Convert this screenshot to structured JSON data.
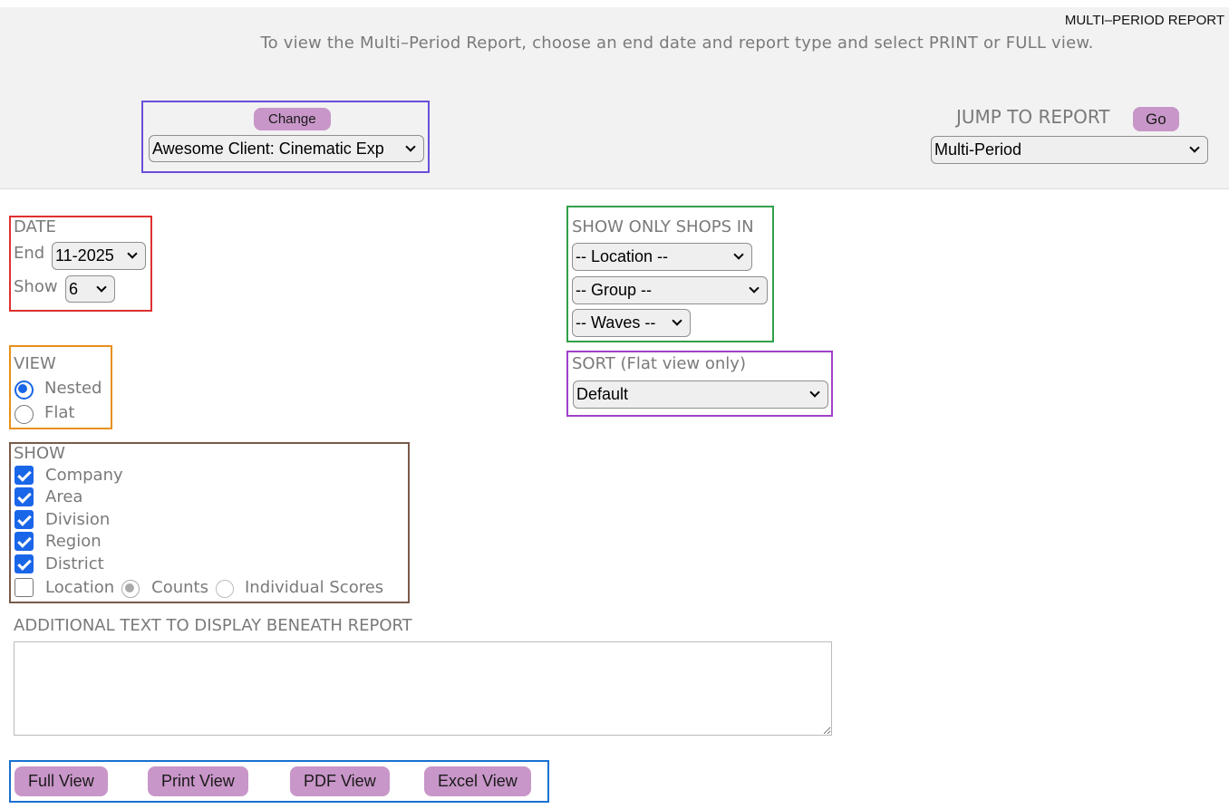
{
  "header": {
    "report_label": "MULTI–PERIOD REPORT",
    "instructions": "To view the Multi–Period Report, choose an end date and report type and select PRINT or FULL view."
  },
  "client": {
    "change_label": "Change",
    "selected": "Awesome Client: Cinematic Exp"
  },
  "jump": {
    "title": "JUMP TO REPORT",
    "go_label": "Go",
    "selected": "Multi-Period"
  },
  "date": {
    "heading": "DATE",
    "end_label": "End",
    "end_value": "11-2025",
    "show_label": "Show",
    "show_value": "6"
  },
  "filters": {
    "heading": "SHOW ONLY SHOPS IN",
    "location": "-- Location --",
    "group": "-- Group --",
    "waves": "-- Waves --"
  },
  "view": {
    "heading": "VIEW",
    "options": [
      {
        "label": "Nested",
        "selected": true
      },
      {
        "label": "Flat",
        "selected": false
      }
    ]
  },
  "sort": {
    "heading": "SORT (Flat view only)",
    "selected": "Default"
  },
  "show": {
    "heading": "SHOW",
    "items": [
      {
        "label": "Company",
        "checked": true
      },
      {
        "label": "Area",
        "checked": true
      },
      {
        "label": "Division",
        "checked": true
      },
      {
        "label": "Region",
        "checked": true
      },
      {
        "label": "District",
        "checked": true
      },
      {
        "label": "Location",
        "checked": false
      }
    ],
    "location_modes": [
      {
        "label": "Counts",
        "selected": true
      },
      {
        "label": "Individual Scores",
        "selected": false
      }
    ]
  },
  "additional": {
    "heading": "ADDITIONAL TEXT TO DISPLAY BENEATH REPORT",
    "value": ""
  },
  "actions": {
    "full": "Full View",
    "print": "Print View",
    "pdf": "PDF View",
    "excel": "Excel View"
  },
  "colors": {
    "button_bg": "#c896c8",
    "accent_blue": "#1a66e8",
    "client_box": "#6a4fd8",
    "date_box": "#e03030",
    "filters_box": "#2fa04a",
    "view_box": "#e8901a",
    "sort_box": "#a040c8",
    "show_box": "#7a5a4a",
    "actions_box": "#1a70d0"
  }
}
